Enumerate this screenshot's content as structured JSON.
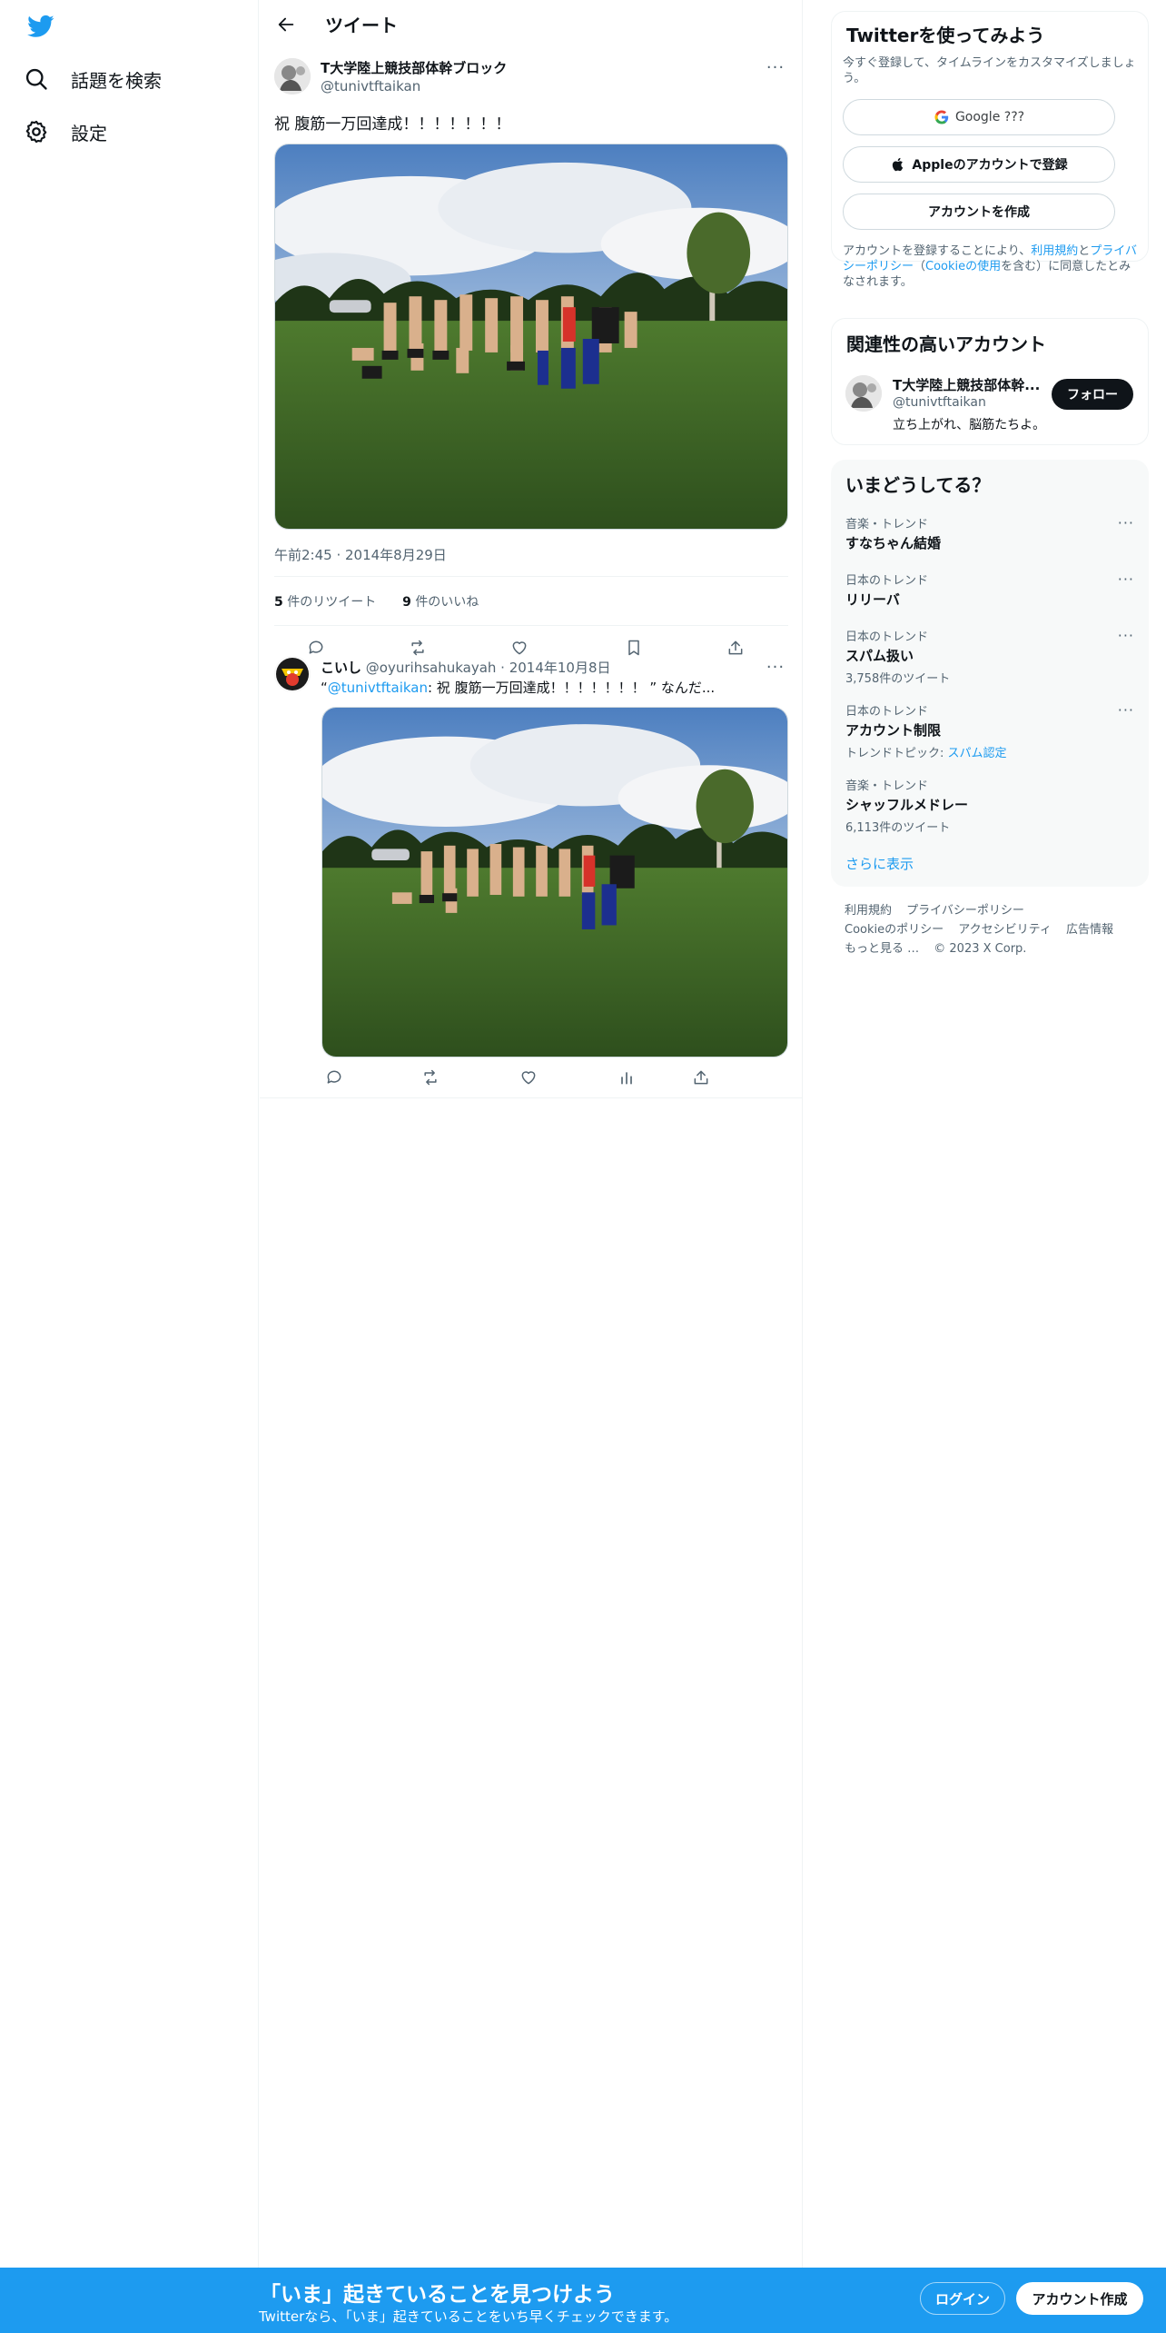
{
  "nav": {
    "explore_label": "話題を検索",
    "settings_label": "設定"
  },
  "header": {
    "title": "ツイート"
  },
  "tweet": {
    "display_name": "T大学陸上競技部体幹ブロック",
    "handle": "@tunivtftaikan",
    "text": "祝 腹筋一万回達成！！！！！！！",
    "timestamp": "午前2:45 · 2014年8月29日",
    "retweets_count": "5",
    "retweets_label": "件のリツイート",
    "likes_count": "9",
    "likes_label": "件のいいね"
  },
  "reply": {
    "display_name": "こいし",
    "handle_date": "@oyurihsahukayah · 2014年10月8日",
    "quote_open": "“",
    "mention": "@tunivtftaikan",
    "text_rest": ": 祝 腹筋一万回達成！！！！！！！ ” なんだ..."
  },
  "signup_card": {
    "title": "Twitterを使ってみよう",
    "subtitle": "今すぐ登録して、タイムラインをカスタマイズしましょう。",
    "google_label": "Google ???",
    "apple_label": "Appleのアカウントで登録",
    "create_label": "アカウントを作成",
    "terms_prefix": "アカウントを登録することにより、",
    "terms_link": "利用規約",
    "terms_and": "と",
    "privacy_link": "プライバシーポリシー",
    "cookie_open": "（",
    "cookie_link": "Cookieの使用",
    "terms_suffix": "を含む）に同意したとみなされます。"
  },
  "relevant": {
    "title": "関連性の高いアカウント",
    "name": "T大学陸上競技部体幹...",
    "handle": "@tunivtftaikan",
    "bio": "立ち上がれ、脳筋たちよ。",
    "follow_label": "フォロー"
  },
  "trends": {
    "title": "いまどうしてる？",
    "items": [
      {
        "meta": "音楽・トレンド",
        "name": "すなちゃん結婚",
        "sub": ""
      },
      {
        "meta": "日本のトレンド",
        "name": "リリーバ",
        "sub": ""
      },
      {
        "meta": "日本のトレンド",
        "name": "スパム扱い",
        "sub": "3,758件のツイート"
      },
      {
        "meta": "日本のトレンド",
        "name": "アカウント制限",
        "sub_prefix": "トレンドトピック: ",
        "sub_link": "スパム認定"
      },
      {
        "meta": "音楽・トレンド",
        "name": "シャッフルメドレー",
        "sub": "6,113件のツイート"
      }
    ],
    "show_more": "さらに表示"
  },
  "footer": {
    "terms": "利用規約",
    "privacy": "プライバシーポリシー",
    "cookie": "Cookieのポリシー",
    "accessibility": "アクセシビリティ",
    "ads": "広告情報",
    "more": "もっと見る …",
    "copyright": "© 2023 X Corp."
  },
  "bottom_bar": {
    "headline": "「いま」起きていることを見つけよう",
    "subline": "Twitterなら、「いま」起きていることをいち早くチェックできます。",
    "login_label": "ログイン",
    "signup_label": "アカウント作成"
  },
  "colors": {
    "brand": "#1d9bf0",
    "text": "#0f1419",
    "muted": "#536471",
    "border": "#eff3f4"
  }
}
